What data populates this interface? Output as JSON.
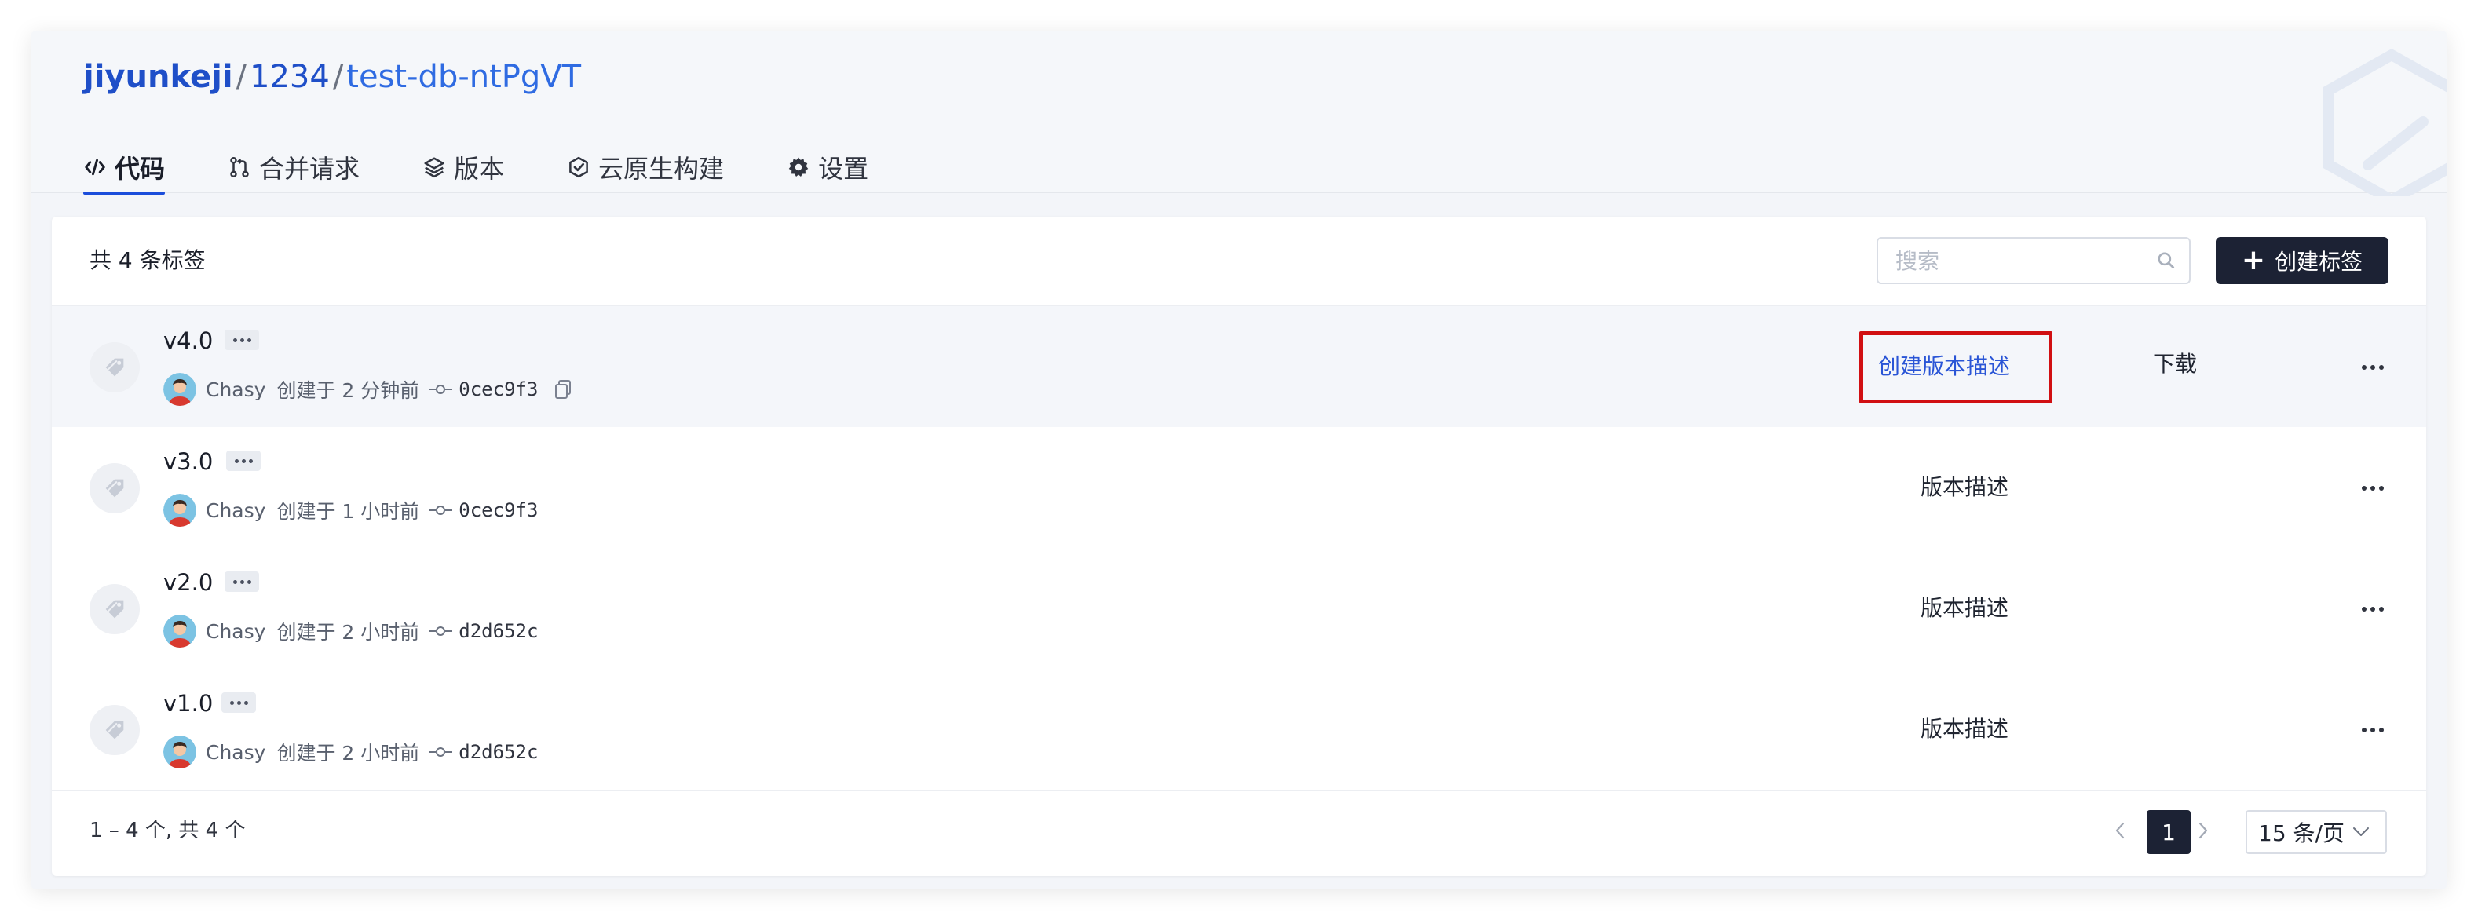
{
  "breadcrumb": {
    "org": "jiyunkeji",
    "group": "1234",
    "repo": "test-db-ntPgVT",
    "separator": "/"
  },
  "tabs": [
    {
      "label": "代码",
      "icon": "code-icon",
      "active": true
    },
    {
      "label": "合并请求",
      "icon": "merge-request-icon",
      "active": false
    },
    {
      "label": "版本",
      "icon": "layers-icon",
      "active": false
    },
    {
      "label": "云原生构建",
      "icon": "cloud-build-icon",
      "active": false
    },
    {
      "label": "设置",
      "icon": "gear-icon",
      "active": false
    }
  ],
  "toolbar": {
    "count_label": "共 4 条标签",
    "search_placeholder": "搜索",
    "create_label": "创建标签"
  },
  "tags": [
    {
      "name": "v4.0",
      "user": "Chasy",
      "created": "创建于 2 分钟前",
      "sha": "0cec9f3",
      "description_action": "创建版本描述",
      "download": "下载",
      "highlighted": true
    },
    {
      "name": "v3.0",
      "user": "Chasy",
      "created": "创建于 1 小时前",
      "sha": "0cec9f3",
      "description_action": "版本描述",
      "download": "",
      "highlighted": false
    },
    {
      "name": "v2.0",
      "user": "Chasy",
      "created": "创建于 2 小时前",
      "sha": "d2d652c",
      "description_action": "版本描述",
      "download": "",
      "highlighted": false
    },
    {
      "name": "v1.0",
      "user": "Chasy",
      "created": "创建于 2 小时前",
      "sha": "d2d652c",
      "description_action": "版本描述",
      "download": "",
      "highlighted": false
    }
  ],
  "pagination": {
    "summary": "1 – 4 个,  共 4 个",
    "current_page": "1",
    "page_size": "15 条/页"
  },
  "colors": {
    "accent": "#2a55d6",
    "primary_dark": "#1c2234",
    "highlight_box": "#d10f12"
  }
}
